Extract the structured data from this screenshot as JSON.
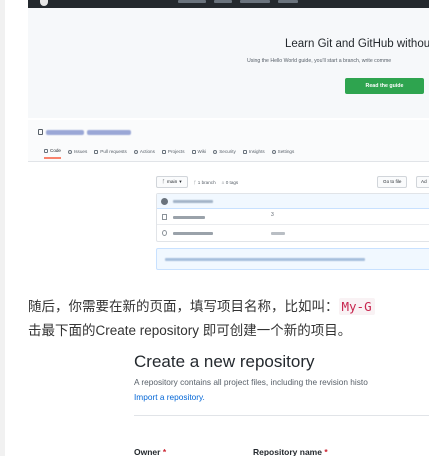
{
  "landing": {
    "hero_title": "Learn Git and GitHub without",
    "hero_subtitle": "Using the Hello World guide, you'll start a branch, write comme",
    "read_guide_button": "Read the guide",
    "colors": {
      "topbar": "#24292e",
      "primary": "#2ea44f"
    }
  },
  "repo": {
    "tabs": [
      {
        "label": "Code",
        "icon": "code-icon"
      },
      {
        "label": "Issues",
        "icon": "issue-icon"
      },
      {
        "label": "Pull requests",
        "icon": "pull-request-icon"
      },
      {
        "label": "Actions",
        "icon": "play-icon"
      },
      {
        "label": "Projects",
        "icon": "project-icon"
      },
      {
        "label": "Wiki",
        "icon": "book-icon"
      },
      {
        "label": "Security",
        "icon": "shield-icon"
      },
      {
        "label": "Insights",
        "icon": "graph-icon"
      },
      {
        "label": "Settings",
        "icon": "gear-icon"
      }
    ],
    "branch_label": "main",
    "branches_count": "1 branch",
    "tags_count": "0 tags",
    "go_to_file": "Go to file",
    "add_file": "Ad",
    "file_row_1_suffix": "3"
  },
  "body": {
    "para1_prefix": "随后，你需要在新的页面，填写项目名称，比如叫：",
    "para1_code": "My-G",
    "para2": "击最下面的Create repository 即可创建一个新的项目。"
  },
  "create": {
    "title": "Create a new repository",
    "description": "A repository contains all project files, including the revision histo",
    "import_link": "Import a repository.",
    "owner_label": "Owner",
    "repo_name_label": "Repository name",
    "required_mark": "*"
  }
}
